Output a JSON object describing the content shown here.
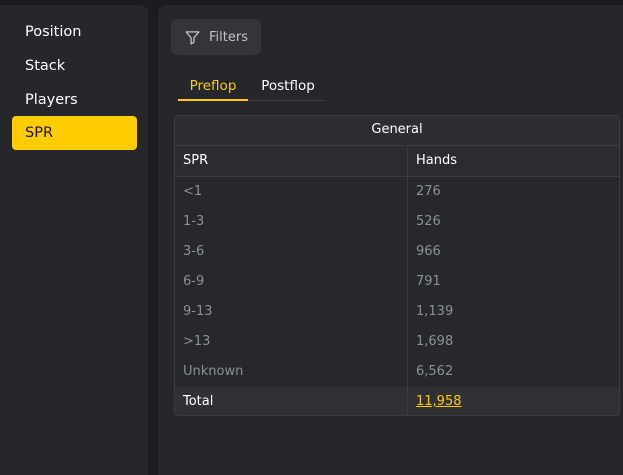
{
  "sidebar": {
    "items": [
      {
        "label": "Position"
      },
      {
        "label": "Stack"
      },
      {
        "label": "Players"
      },
      {
        "label": "SPR"
      }
    ],
    "active": "SPR"
  },
  "toolbar": {
    "filters_label": "Filters",
    "filters_icon": "funnel-icon"
  },
  "tabs": [
    {
      "label": "Preflop",
      "active": true
    },
    {
      "label": "Postflop",
      "active": false
    }
  ],
  "table": {
    "group_header": "General",
    "columns": [
      "SPR",
      "Hands"
    ],
    "rows": [
      {
        "spr": "<1",
        "hands": "276"
      },
      {
        "spr": "1-3",
        "hands": "526"
      },
      {
        "spr": "3-6",
        "hands": "966"
      },
      {
        "spr": "6-9",
        "hands": "791"
      },
      {
        "spr": "9-13",
        "hands": "1,139"
      },
      {
        "spr": ">13",
        "hands": "1,698"
      },
      {
        "spr": "Unknown",
        "hands": "6,562"
      }
    ],
    "total": {
      "label": "Total",
      "hands": "11,958"
    }
  },
  "colors": {
    "accent": "#ffcc00",
    "background": "#1b1c1f",
    "panel": "#25272b"
  }
}
